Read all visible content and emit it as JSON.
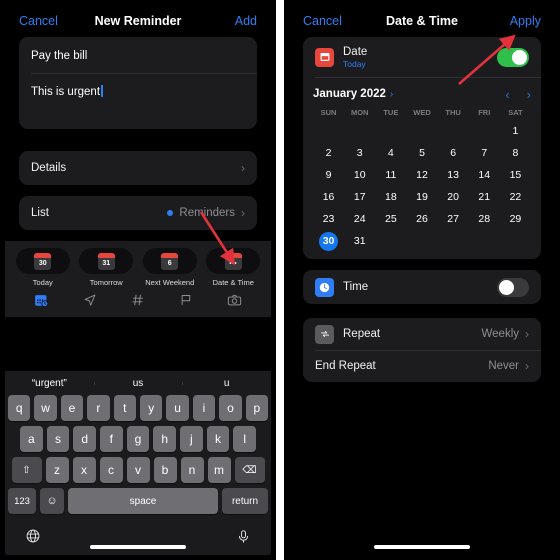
{
  "left_panel": {
    "nav": {
      "cancel_label": "Cancel",
      "title": "New Reminder",
      "add_label": "Add"
    },
    "fields": {
      "title_value": "Pay the bill",
      "note_value": "This is urgent"
    },
    "details_row": {
      "label": "Details",
      "chevron": "›"
    },
    "list_row": {
      "label": "List",
      "value": "Reminders",
      "chevron": "›"
    },
    "quick_actions": [
      {
        "name": "today",
        "icon_text": "30",
        "label": "Today"
      },
      {
        "name": "tomorrow",
        "icon_text": "31",
        "label": "Tomorrow"
      },
      {
        "name": "next-weekend",
        "icon_text": "6",
        "label": "Next Weekend"
      },
      {
        "name": "date-time",
        "icon_text": "•••",
        "label": "Date & Time"
      }
    ],
    "toolbar_icons": [
      {
        "name": "calendar-clock-icon",
        "active": true
      },
      {
        "name": "location-arrow-icon",
        "active": false
      },
      {
        "name": "hashtag-icon",
        "active": false
      },
      {
        "name": "flag-icon",
        "active": false
      },
      {
        "name": "camera-icon",
        "active": false
      }
    ],
    "keyboard": {
      "suggestions": [
        "“urgent”",
        "us",
        "u"
      ],
      "row1": [
        "q",
        "w",
        "e",
        "r",
        "t",
        "y",
        "u",
        "i",
        "o",
        "p"
      ],
      "row2": [
        "a",
        "s",
        "d",
        "f",
        "g",
        "h",
        "j",
        "k",
        "l"
      ],
      "row3": [
        "z",
        "x",
        "c",
        "v",
        "b",
        "n",
        "m"
      ],
      "shift_label": "⇧",
      "backspace_label": "⌫",
      "numbers_label": "123",
      "emoji_label": "☺",
      "space_label": "space",
      "return_label": "return",
      "globe_label": "⊕",
      "mic_label": "⌥"
    }
  },
  "right_panel": {
    "nav": {
      "cancel_label": "Cancel",
      "title": "Date & Time",
      "apply_label": "Apply"
    },
    "date_row": {
      "label": "Date",
      "sub_label": "Today",
      "toggle_on": true
    },
    "calendar": {
      "month_label": "January 2022",
      "month_caret": "›",
      "prev_label": "‹",
      "next_label": "›",
      "weekdays": [
        "SUN",
        "MON",
        "TUE",
        "WED",
        "THU",
        "FRI",
        "SAT"
      ],
      "leading_blanks": 6,
      "days": [
        1,
        2,
        3,
        4,
        5,
        6,
        7,
        8,
        9,
        10,
        11,
        12,
        13,
        14,
        15,
        16,
        17,
        18,
        19,
        20,
        21,
        22,
        23,
        24,
        25,
        26,
        27,
        28,
        29,
        30,
        31
      ],
      "selected_day": 30
    },
    "time_row": {
      "label": "Time",
      "toggle_on": false
    },
    "repeat_row": {
      "label": "Repeat",
      "value": "Weekly",
      "chevron": "›"
    },
    "end_repeat_row": {
      "label": "End Repeat",
      "value": "Never",
      "chevron": "›"
    }
  },
  "annotations": {
    "arrow_color": "#e2323c",
    "left_arrow_target": "date-time-chip",
    "right_arrow_target": "apply-button"
  }
}
